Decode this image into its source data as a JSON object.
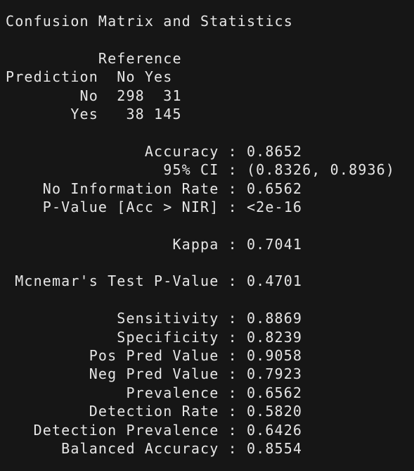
{
  "title": "Confusion Matrix and Statistics",
  "matrix": {
    "reference_label": "Reference",
    "prediction_label": "Prediction",
    "columns": [
      "No",
      "Yes"
    ],
    "rows": [
      {
        "label": "No",
        "values": [
          "298",
          "31"
        ]
      },
      {
        "label": "Yes",
        "values": [
          "38",
          "145"
        ]
      }
    ]
  },
  "stats_group1": [
    {
      "label": "Accuracy",
      "value": "0.8652"
    },
    {
      "label": "95% CI",
      "value": "(0.8326, 0.8936)"
    },
    {
      "label": "No Information Rate",
      "value": "0.6562"
    },
    {
      "label": "P-Value [Acc > NIR]",
      "value": "<2e-16"
    }
  ],
  "stats_group2": [
    {
      "label": "Kappa",
      "value": "0.7041"
    }
  ],
  "stats_group3": [
    {
      "label": "Mcnemar's Test P-Value",
      "value": "0.4701"
    }
  ],
  "stats_group4": [
    {
      "label": "Sensitivity",
      "value": "0.8869"
    },
    {
      "label": "Specificity",
      "value": "0.8239"
    },
    {
      "label": "Pos Pred Value",
      "value": "0.9058"
    },
    {
      "label": "Neg Pred Value",
      "value": "0.7923"
    },
    {
      "label": "Prevalence",
      "value": "0.6562"
    },
    {
      "label": "Detection Rate",
      "value": "0.5820"
    },
    {
      "label": "Detection Prevalence",
      "value": "0.6426"
    },
    {
      "label": "Balanced Accuracy",
      "value": "0.8554"
    }
  ]
}
